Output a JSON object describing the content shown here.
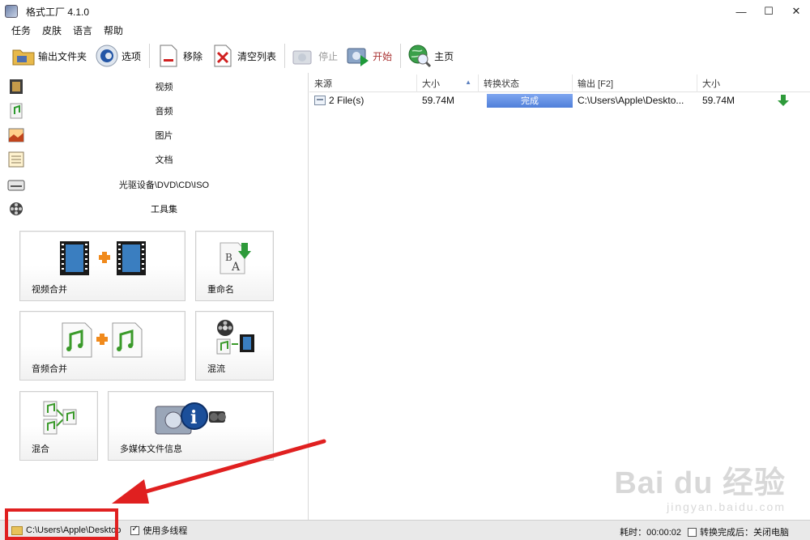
{
  "window": {
    "title": "格式工厂 4.1.0",
    "controls": [
      "—",
      "☐",
      "✕"
    ]
  },
  "menu": [
    "任务",
    "皮肤",
    "语言",
    "帮助"
  ],
  "toolbar": {
    "output_folder": "输出文件夹",
    "options": "选项",
    "remove": "移除",
    "clear_list": "清空列表",
    "stop": "停止",
    "start": "开始",
    "home": "主页"
  },
  "categories": [
    {
      "label": "视频",
      "icon": "video-icon"
    },
    {
      "label": "音频",
      "icon": "audio-icon"
    },
    {
      "label": "图片",
      "icon": "picture-icon"
    },
    {
      "label": "文档",
      "icon": "document-icon"
    },
    {
      "label": "光驱设备\\DVD\\CD\\ISO",
      "icon": "optical-drive-icon"
    },
    {
      "label": "工具集",
      "icon": "toolbox-icon"
    }
  ],
  "tiles": {
    "video_merge": "视频合并",
    "rename": "重命名",
    "audio_merge": "音频合并",
    "mux": "混流",
    "mix": "混合",
    "media_info": "多媒体文件信息"
  },
  "file_list": {
    "columns": [
      "来源",
      "大小",
      "转换状态",
      "输出 [F2]",
      "大小"
    ],
    "rows": [
      {
        "source": "2 File(s)",
        "size": "59.74M",
        "status": "完成",
        "output": "C:\\Users\\Apple\\Deskto...",
        "out_size": "59.74M"
      }
    ]
  },
  "statusbar": {
    "path": "C:\\Users\\Apple\\Desktop",
    "multithread_label": "使用多线程",
    "multithread_checked": true,
    "elapsed": "耗时：00:00:02",
    "after_done": "转换完成后：关闭电脑"
  },
  "watermark": {
    "main": "Bai du 经验",
    "sub": "jingyan.baidu.com"
  },
  "colors": {
    "status_done": "#4f7fd9",
    "annotation": "#e02020",
    "start_label": "#a33333"
  }
}
